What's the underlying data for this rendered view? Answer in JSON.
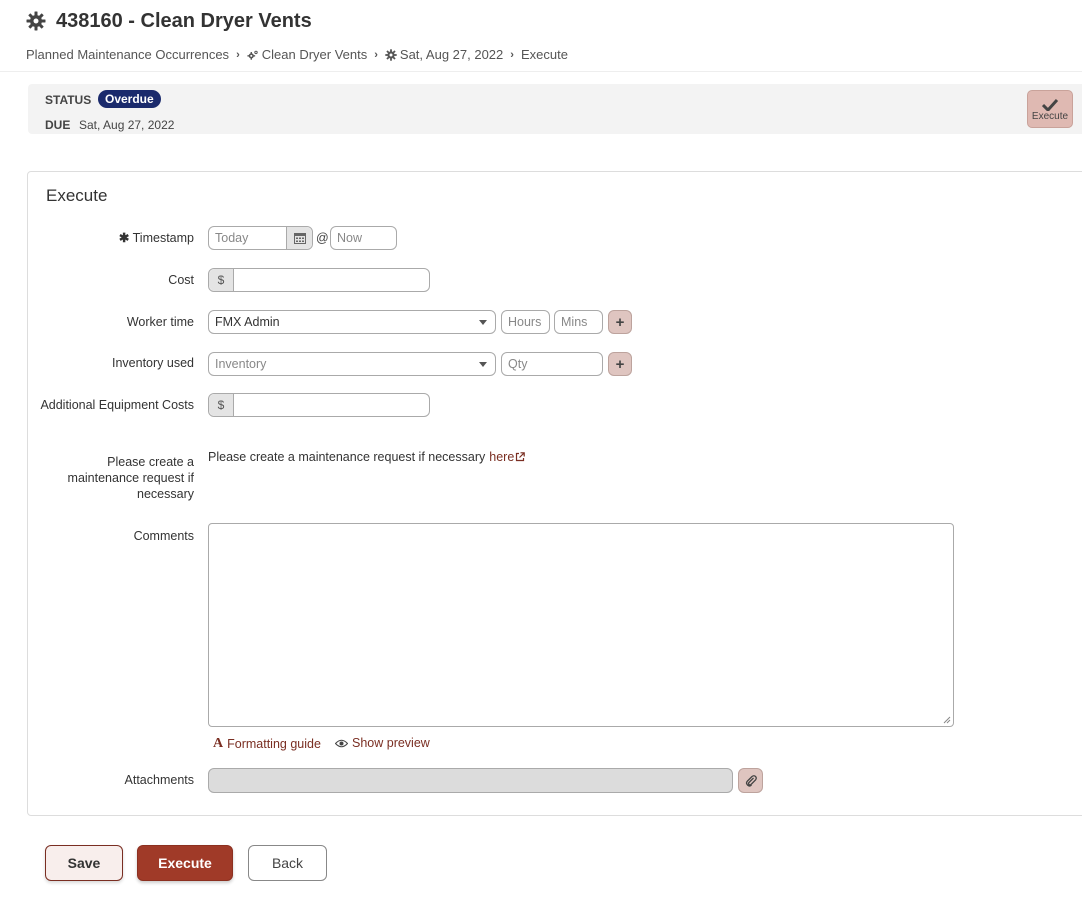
{
  "header": {
    "title": "438160 - Clean Dryer Vents",
    "title_icon": "gear-icon"
  },
  "breadcrumb": {
    "items": [
      {
        "label": "Planned Maintenance Occurrences",
        "icon": ""
      },
      {
        "label": "Clean Dryer Vents",
        "icon": "gears-icon"
      },
      {
        "label": "Sat, Aug 27, 2022",
        "icon": "gear-icon"
      },
      {
        "label": "Execute",
        "icon": ""
      }
    ]
  },
  "status": {
    "status_label": "STATUS",
    "status_value": "Overdue",
    "due_label": "DUE",
    "due_value": "Sat, Aug 27, 2022",
    "action_label": "Execute",
    "badge_color": "#1a2a6c"
  },
  "form": {
    "title": "Execute",
    "timestamp": {
      "label": "Timestamp",
      "date_placeholder": "Today",
      "at": "@",
      "time_placeholder": "Now"
    },
    "cost": {
      "label": "Cost",
      "prefix": "$",
      "value": ""
    },
    "worker_time": {
      "label": "Worker time",
      "selected": "FMX Admin",
      "hours_placeholder": "Hours",
      "mins_placeholder": "Mins"
    },
    "inventory": {
      "label": "Inventory used",
      "placeholder": "Inventory",
      "qty_placeholder": "Qty"
    },
    "equipment_costs": {
      "label": "Additional Equipment Costs",
      "prefix": "$",
      "value": ""
    },
    "maintenance_request": {
      "label": "Please create a maintenance request if necessary",
      "text": "Please create a maintenance request if necessary",
      "link": "here"
    },
    "comments": {
      "label": "Comments",
      "value": ""
    },
    "formatting_guide": "Formatting guide",
    "show_preview": "Show preview",
    "attachments": {
      "label": "Attachments"
    }
  },
  "buttons": {
    "save": "Save",
    "execute": "Execute",
    "back": "Back"
  },
  "colors": {
    "accent": "#a03a28",
    "link": "#7a2e22"
  }
}
